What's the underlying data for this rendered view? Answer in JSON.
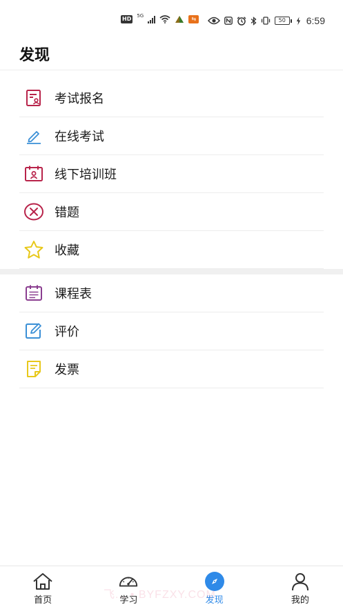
{
  "status_bar": {
    "hd": "HD",
    "network": "5G",
    "battery": "50",
    "time": "6:59",
    "left_icons": [
      "hd-icon",
      "signal-icon",
      "wifi-icon",
      "warning-icon",
      "app-notification-icon"
    ],
    "right_icons": [
      "eye-icon",
      "nfc-icon",
      "alarm-icon",
      "bluetooth-icon",
      "vibrate-icon",
      "battery-icon",
      "charging-icon"
    ]
  },
  "header": {
    "title": "发现"
  },
  "menu_group_1": [
    {
      "label": "考试报名",
      "icon": "exam-registration-icon",
      "color": "#b8234a"
    },
    {
      "label": "在线考试",
      "icon": "pen-icon",
      "color": "#3a8fd6"
    },
    {
      "label": "线下培训班",
      "icon": "training-calendar-icon",
      "color": "#b8234a"
    },
    {
      "label": "错题",
      "icon": "wrong-circle-icon",
      "color": "#b8234a"
    },
    {
      "label": "收藏",
      "icon": "star-icon",
      "color": "#e8c81a"
    }
  ],
  "menu_group_2": [
    {
      "label": "课程表",
      "icon": "schedule-icon",
      "color": "#8a3d8f"
    },
    {
      "label": "评价",
      "icon": "edit-review-icon",
      "color": "#3a8fd6"
    },
    {
      "label": "发票",
      "icon": "invoice-icon",
      "color": "#e8c81a"
    }
  ],
  "tabbar": {
    "tabs": [
      {
        "label": "首页",
        "icon": "home-icon",
        "active": false
      },
      {
        "label": "学习",
        "icon": "speedometer-icon",
        "active": false
      },
      {
        "label": "发现",
        "icon": "compass-icon",
        "active": true
      },
      {
        "label": "我的",
        "icon": "user-icon",
        "active": false
      }
    ],
    "active_color": "#2f8ae8"
  },
  "watermark": "飞... • BYFZXY.COM"
}
